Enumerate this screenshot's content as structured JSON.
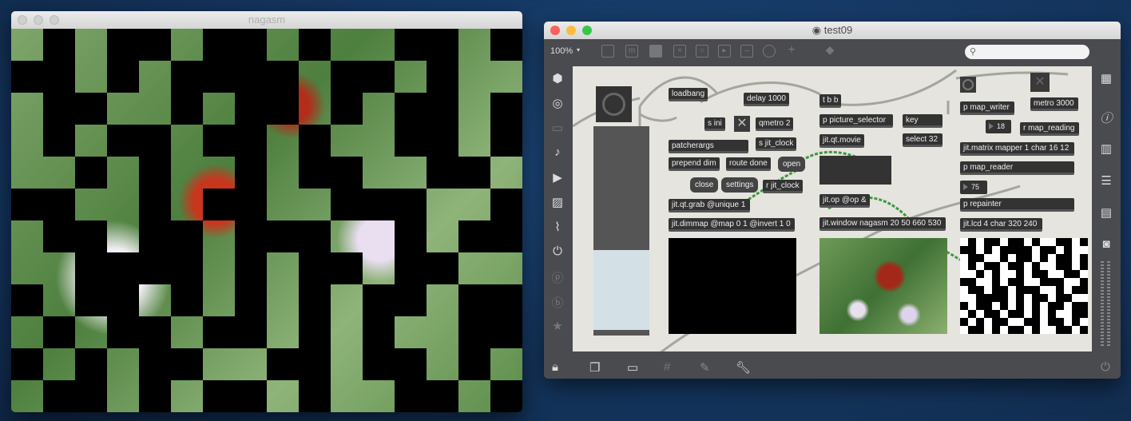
{
  "left_window": {
    "title": "nagasm"
  },
  "right_window": {
    "title": "test09",
    "toolbar": {
      "zoom": "100%",
      "zoom_arrow": "▾",
      "search_placeholder": ""
    },
    "objects": {
      "loadbang": "loadbang",
      "delay": "delay 1000",
      "s_ini": "s ini",
      "qmetro": "qmetro 2",
      "s_jit_clock": "s jit_clock",
      "patcherargs": "patcherargs",
      "prepend": "prepend dim",
      "route": "route done",
      "open": "open",
      "close": "close",
      "settings": "settings",
      "r_jit_clock": "r jit_clock",
      "grab": "jit.qt.grab @unique 1",
      "dimmap": "jit.dimmap @map 0 1 @invert 1 0",
      "tbb": "t b b",
      "picture_selector": "p picture_selector",
      "key": "key",
      "select": "select 32",
      "movie": "jit.qt.movie",
      "op": "jit.op @op &",
      "window": "jit.window nagasm 20 50 660 530",
      "map_writer": "p map_writer",
      "metro": "metro 3000",
      "num18": "18",
      "r_map_reading": "r map_reading",
      "matrix": "jit.matrix mapper 1 char 16 12",
      "map_reader": "p map_reader",
      "num75": "75",
      "repainter": "p repainter",
      "lcd": "jit.lcd 4 char 320 240"
    },
    "colors": {
      "canvas": "#e5e4de",
      "object": "#333333",
      "patch_cord_jitter": "#3c9a3c"
    }
  }
}
